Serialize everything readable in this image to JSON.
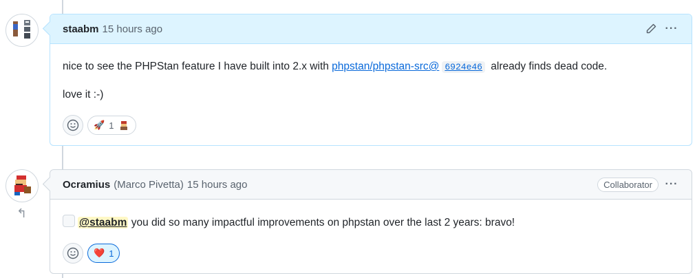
{
  "comments": [
    {
      "author": "staabm",
      "timestamp": "15 hours ago",
      "paragraph1_before": "nice to see the PHPStan feature I have built into 2.x with ",
      "link_text": "phpstan/phpstan-src@",
      "sha": "6924e46",
      "paragraph1_after": " already finds dead code.",
      "paragraph2": "love it :-)",
      "reactions": [
        {
          "emoji": "🚀",
          "count": "1"
        }
      ],
      "icons": {
        "edit": "pencil-icon",
        "more": "kebab-icon",
        "add_reaction": "smiley-icon"
      }
    },
    {
      "author": "Ocramius",
      "full_name": "(Marco Pivetta)",
      "timestamp": "15 hours ago",
      "badge": "Collaborator",
      "mention": "@staabm",
      "text_after": " you did so many impactful improvements on phpstan over the last 2 years: bravo!",
      "reactions": [
        {
          "emoji": "❤️",
          "count": "1"
        }
      ],
      "icons": {
        "more": "kebab-icon",
        "add_reaction": "smiley-icon",
        "reply": "reply-arrow-icon"
      }
    }
  ]
}
